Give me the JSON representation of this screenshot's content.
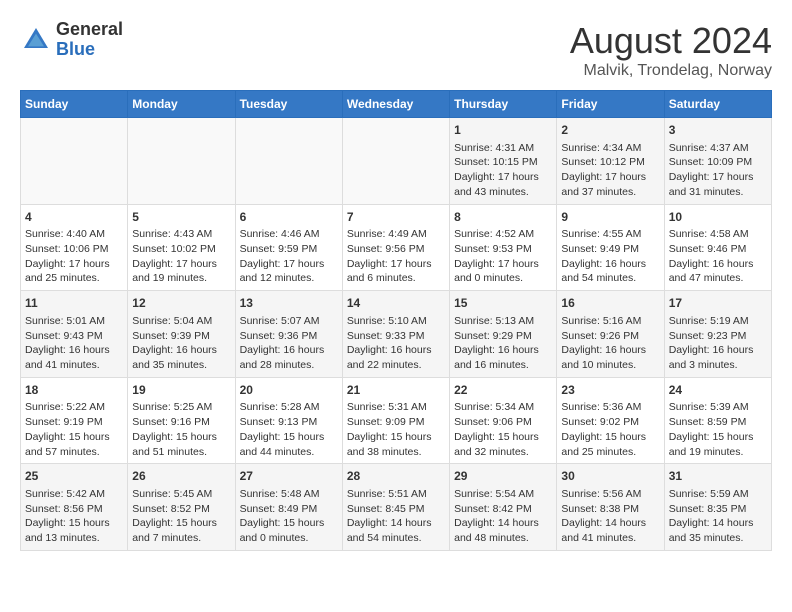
{
  "logo": {
    "general": "General",
    "blue": "Blue"
  },
  "title": {
    "month_year": "August 2024",
    "location": "Malvik, Trondelag, Norway"
  },
  "headers": [
    "Sunday",
    "Monday",
    "Tuesday",
    "Wednesday",
    "Thursday",
    "Friday",
    "Saturday"
  ],
  "weeks": [
    [
      {
        "day": "",
        "content": ""
      },
      {
        "day": "",
        "content": ""
      },
      {
        "day": "",
        "content": ""
      },
      {
        "day": "",
        "content": ""
      },
      {
        "day": "1",
        "content": "Sunrise: 4:31 AM\nSunset: 10:15 PM\nDaylight: 17 hours\nand 43 minutes."
      },
      {
        "day": "2",
        "content": "Sunrise: 4:34 AM\nSunset: 10:12 PM\nDaylight: 17 hours\nand 37 minutes."
      },
      {
        "day": "3",
        "content": "Sunrise: 4:37 AM\nSunset: 10:09 PM\nDaylight: 17 hours\nand 31 minutes."
      }
    ],
    [
      {
        "day": "4",
        "content": "Sunrise: 4:40 AM\nSunset: 10:06 PM\nDaylight: 17 hours\nand 25 minutes."
      },
      {
        "day": "5",
        "content": "Sunrise: 4:43 AM\nSunset: 10:02 PM\nDaylight: 17 hours\nand 19 minutes."
      },
      {
        "day": "6",
        "content": "Sunrise: 4:46 AM\nSunset: 9:59 PM\nDaylight: 17 hours\nand 12 minutes."
      },
      {
        "day": "7",
        "content": "Sunrise: 4:49 AM\nSunset: 9:56 PM\nDaylight: 17 hours\nand 6 minutes."
      },
      {
        "day": "8",
        "content": "Sunrise: 4:52 AM\nSunset: 9:53 PM\nDaylight: 17 hours\nand 0 minutes."
      },
      {
        "day": "9",
        "content": "Sunrise: 4:55 AM\nSunset: 9:49 PM\nDaylight: 16 hours\nand 54 minutes."
      },
      {
        "day": "10",
        "content": "Sunrise: 4:58 AM\nSunset: 9:46 PM\nDaylight: 16 hours\nand 47 minutes."
      }
    ],
    [
      {
        "day": "11",
        "content": "Sunrise: 5:01 AM\nSunset: 9:43 PM\nDaylight: 16 hours\nand 41 minutes."
      },
      {
        "day": "12",
        "content": "Sunrise: 5:04 AM\nSunset: 9:39 PM\nDaylight: 16 hours\nand 35 minutes."
      },
      {
        "day": "13",
        "content": "Sunrise: 5:07 AM\nSunset: 9:36 PM\nDaylight: 16 hours\nand 28 minutes."
      },
      {
        "day": "14",
        "content": "Sunrise: 5:10 AM\nSunset: 9:33 PM\nDaylight: 16 hours\nand 22 minutes."
      },
      {
        "day": "15",
        "content": "Sunrise: 5:13 AM\nSunset: 9:29 PM\nDaylight: 16 hours\nand 16 minutes."
      },
      {
        "day": "16",
        "content": "Sunrise: 5:16 AM\nSunset: 9:26 PM\nDaylight: 16 hours\nand 10 minutes."
      },
      {
        "day": "17",
        "content": "Sunrise: 5:19 AM\nSunset: 9:23 PM\nDaylight: 16 hours\nand 3 minutes."
      }
    ],
    [
      {
        "day": "18",
        "content": "Sunrise: 5:22 AM\nSunset: 9:19 PM\nDaylight: 15 hours\nand 57 minutes."
      },
      {
        "day": "19",
        "content": "Sunrise: 5:25 AM\nSunset: 9:16 PM\nDaylight: 15 hours\nand 51 minutes."
      },
      {
        "day": "20",
        "content": "Sunrise: 5:28 AM\nSunset: 9:13 PM\nDaylight: 15 hours\nand 44 minutes."
      },
      {
        "day": "21",
        "content": "Sunrise: 5:31 AM\nSunset: 9:09 PM\nDaylight: 15 hours\nand 38 minutes."
      },
      {
        "day": "22",
        "content": "Sunrise: 5:34 AM\nSunset: 9:06 PM\nDaylight: 15 hours\nand 32 minutes."
      },
      {
        "day": "23",
        "content": "Sunrise: 5:36 AM\nSunset: 9:02 PM\nDaylight: 15 hours\nand 25 minutes."
      },
      {
        "day": "24",
        "content": "Sunrise: 5:39 AM\nSunset: 8:59 PM\nDaylight: 15 hours\nand 19 minutes."
      }
    ],
    [
      {
        "day": "25",
        "content": "Sunrise: 5:42 AM\nSunset: 8:56 PM\nDaylight: 15 hours\nand 13 minutes."
      },
      {
        "day": "26",
        "content": "Sunrise: 5:45 AM\nSunset: 8:52 PM\nDaylight: 15 hours\nand 7 minutes."
      },
      {
        "day": "27",
        "content": "Sunrise: 5:48 AM\nSunset: 8:49 PM\nDaylight: 15 hours\nand 0 minutes."
      },
      {
        "day": "28",
        "content": "Sunrise: 5:51 AM\nSunset: 8:45 PM\nDaylight: 14 hours\nand 54 minutes."
      },
      {
        "day": "29",
        "content": "Sunrise: 5:54 AM\nSunset: 8:42 PM\nDaylight: 14 hours\nand 48 minutes."
      },
      {
        "day": "30",
        "content": "Sunrise: 5:56 AM\nSunset: 8:38 PM\nDaylight: 14 hours\nand 41 minutes."
      },
      {
        "day": "31",
        "content": "Sunrise: 5:59 AM\nSunset: 8:35 PM\nDaylight: 14 hours\nand 35 minutes."
      }
    ]
  ]
}
